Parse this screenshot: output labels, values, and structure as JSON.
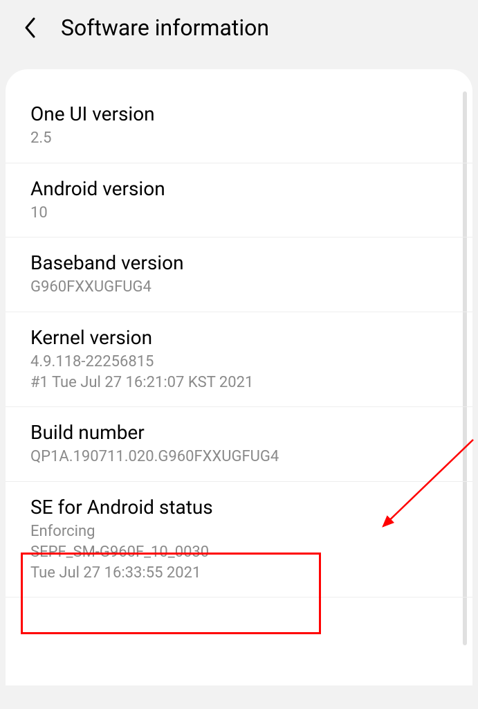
{
  "header": {
    "title": "Software information"
  },
  "items": [
    {
      "title": "One UI version",
      "lines": [
        "2.5"
      ]
    },
    {
      "title": "Android version",
      "lines": [
        "10"
      ]
    },
    {
      "title": "Baseband version",
      "lines": [
        "G960FXXUGFUG4"
      ]
    },
    {
      "title": "Kernel version",
      "lines": [
        "4.9.118-22256815",
        "#1 Tue Jul 27 16:21:07 KST 2021"
      ]
    },
    {
      "title": "Build number",
      "lines": [
        "QP1A.190711.020.G960FXXUGFUG4"
      ]
    },
    {
      "title": "SE for Android status",
      "lines": [
        "Enforcing",
        "SEPF_SM-G960F_10_0030",
        "Tue Jul 27 16:33:55 2021"
      ]
    }
  ],
  "annotation": {
    "highlight_color": "#ff0000"
  }
}
